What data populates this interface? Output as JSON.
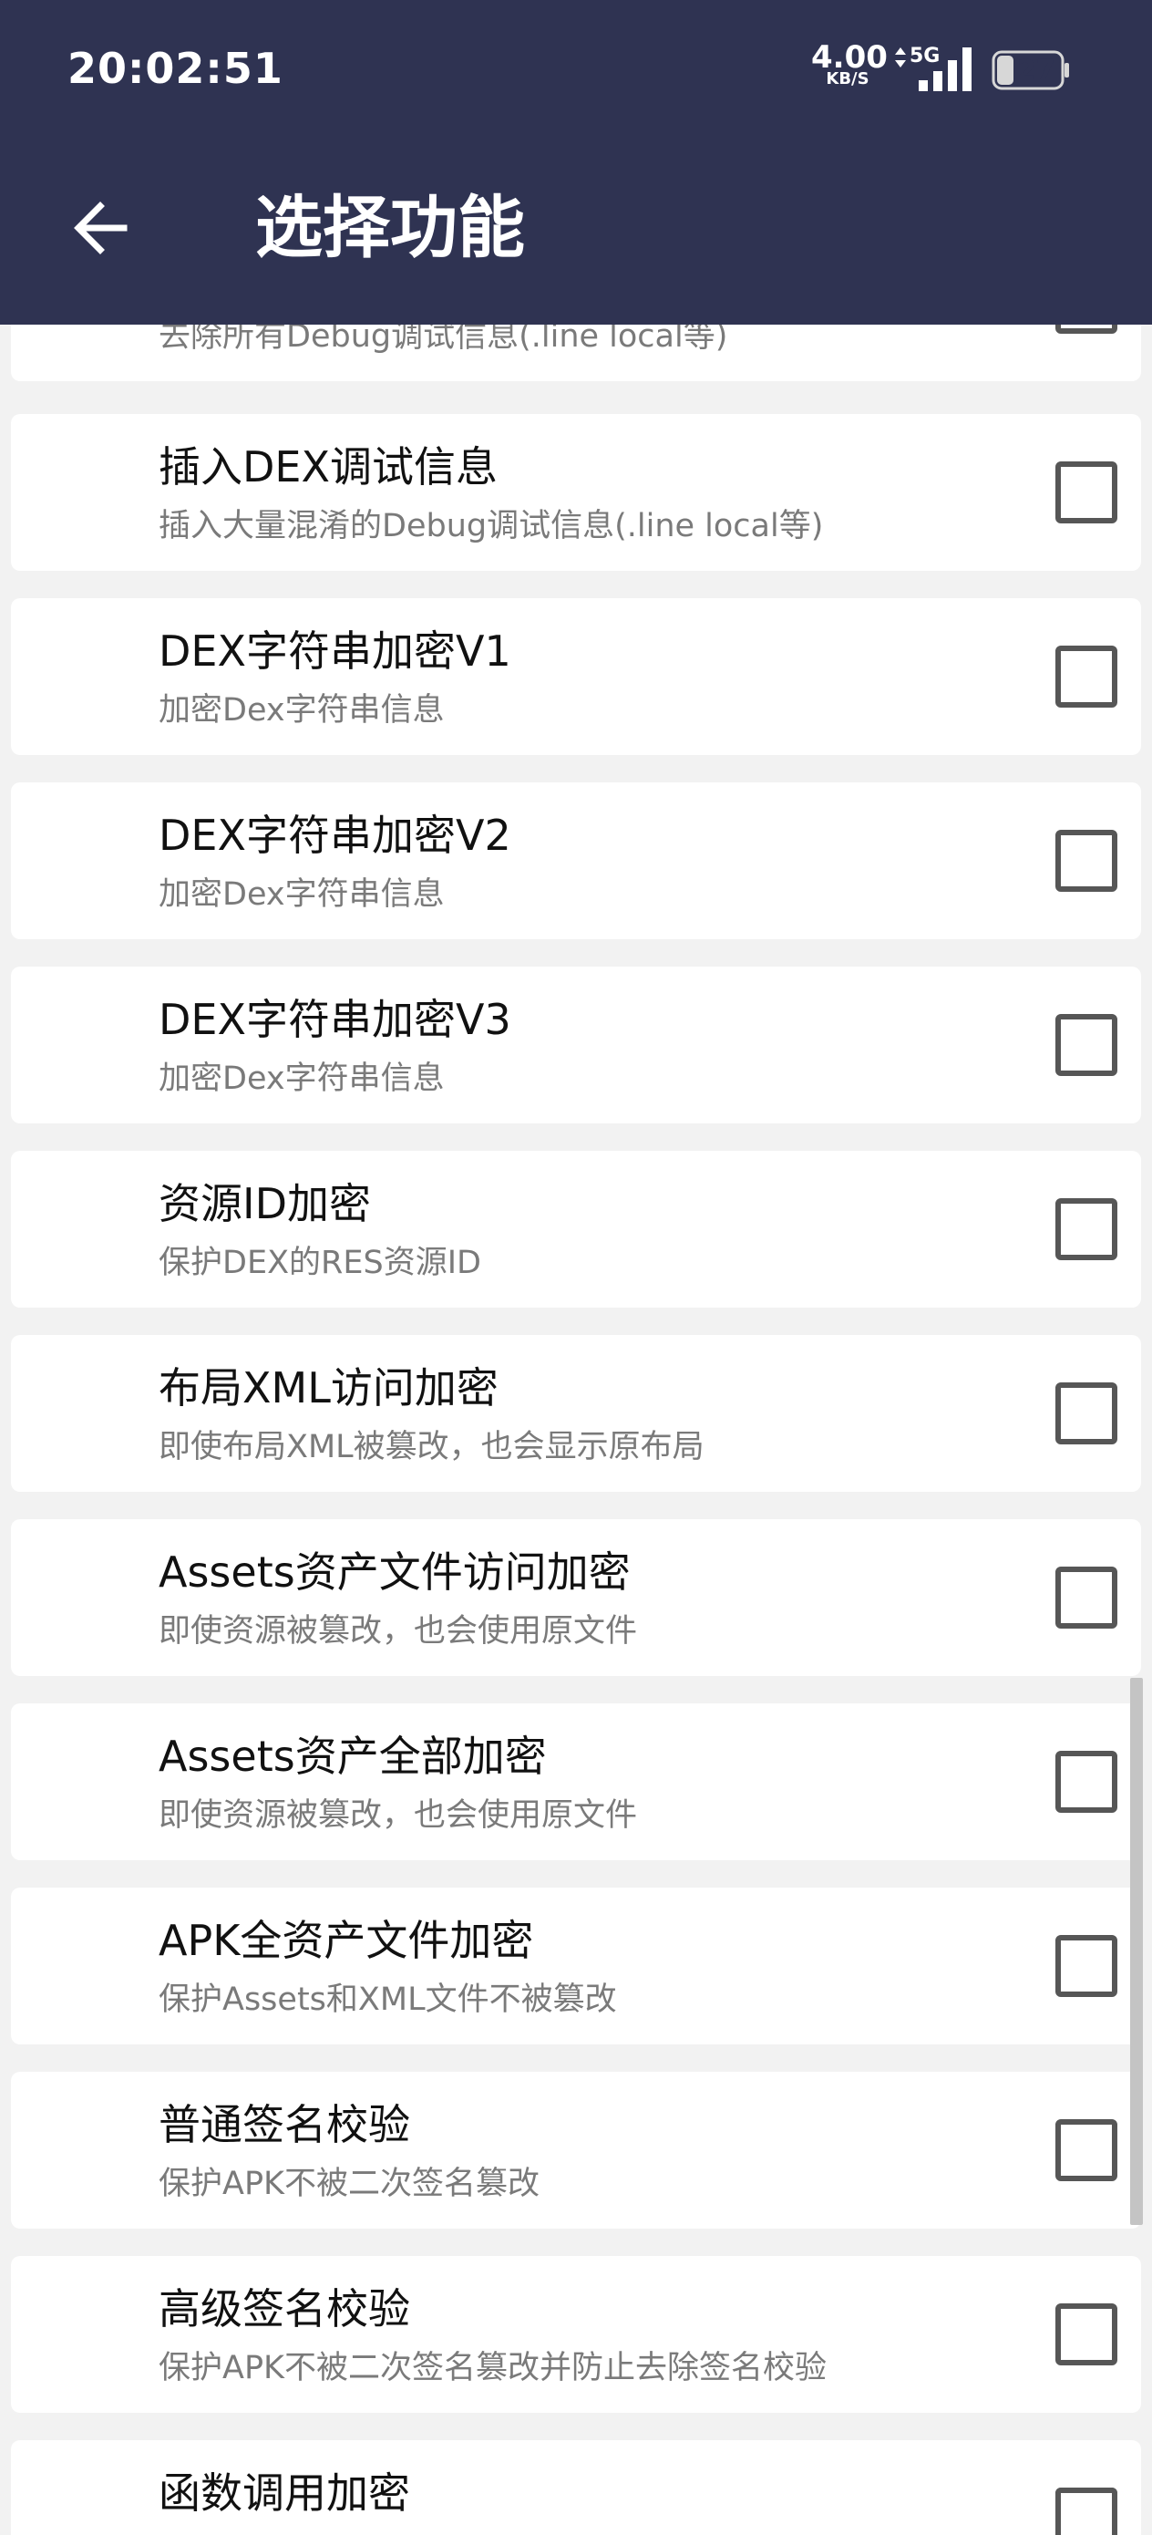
{
  "status_bar": {
    "time": "20:02:51",
    "net_speed_value": "4.00",
    "net_speed_unit": "KB/S",
    "network_type": "5G",
    "battery_level": "27"
  },
  "toolbar": {
    "title": "选择功能",
    "back_icon": "arrow-left-icon"
  },
  "features": [
    {
      "title": "",
      "desc": "去除所有Debug调试信息(.line local等)",
      "checked": false
    },
    {
      "title": "插入DEX调试信息",
      "desc": "插入大量混淆的Debug调试信息(.line local等)",
      "checked": false
    },
    {
      "title": "DEX字符串加密V1",
      "desc": "加密Dex字符串信息",
      "checked": false
    },
    {
      "title": "DEX字符串加密V2",
      "desc": "加密Dex字符串信息",
      "checked": false
    },
    {
      "title": "DEX字符串加密V3",
      "desc": "加密Dex字符串信息",
      "checked": false
    },
    {
      "title": "资源ID加密",
      "desc": "保护DEX的RES资源ID",
      "checked": false
    },
    {
      "title": "布局XML访问加密",
      "desc": "即使布局XML被篡改，也会显示原布局",
      "checked": false
    },
    {
      "title": "Assets资产文件访问加密",
      "desc": "即使资源被篡改，也会使用原文件",
      "checked": false
    },
    {
      "title": "Assets资产全部加密",
      "desc": "即使资源被篡改，也会使用原文件",
      "checked": false
    },
    {
      "title": "APK全资产文件加密",
      "desc": "保护Assets和XML文件不被篡改",
      "checked": false
    },
    {
      "title": "普通签名校验",
      "desc": "保护APK不被二次签名篡改",
      "checked": false
    },
    {
      "title": "高级签名校验",
      "desc": "保护APK不被二次签名篡改并防止去除签名校验",
      "checked": false
    },
    {
      "title": "函数调用加密",
      "desc": "",
      "checked": false
    }
  ],
  "colors": {
    "appbar": "#2f3352",
    "background": "#f2f2f2",
    "card": "#ffffff",
    "checkbox_border": "#565656"
  }
}
